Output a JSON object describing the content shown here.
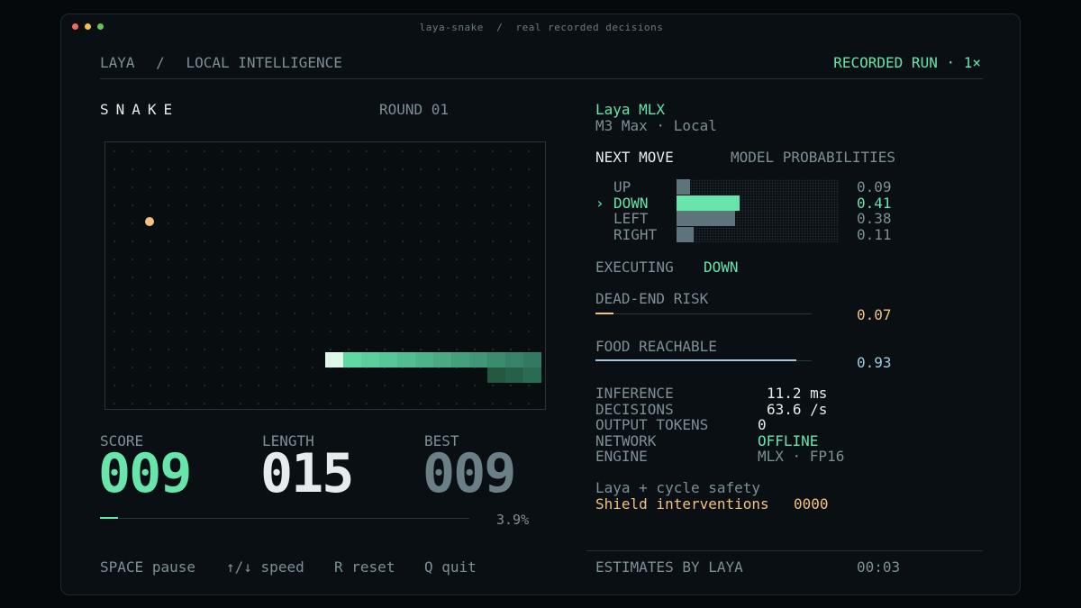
{
  "window": {
    "title": "laya-snake  /  real recorded decisions",
    "dot_colors": [
      "#ee6a5e",
      "#f5be4f",
      "#62c554"
    ]
  },
  "header": {
    "brand": "LAYA",
    "separator": "/",
    "section": "LOCAL INTELLIGENCE",
    "mode": "RECORDED RUN · 1×"
  },
  "game": {
    "title": "SNAKE",
    "round": "ROUND 01",
    "board": {
      "cols": 24,
      "rows": 15
    },
    "food": {
      "col": 1,
      "row": 4
    },
    "snake": [
      {
        "col": 12,
        "row": 12,
        "color": "#dff8ec"
      },
      {
        "col": 13,
        "row": 12,
        "color": "#5fd8a2"
      },
      {
        "col": 14,
        "row": 12,
        "color": "#5bd09d"
      },
      {
        "col": 15,
        "row": 12,
        "color": "#56c797"
      },
      {
        "col": 16,
        "row": 12,
        "color": "#52bd90"
      },
      {
        "col": 17,
        "row": 12,
        "color": "#4db38a"
      },
      {
        "col": 18,
        "row": 12,
        "color": "#49aa83"
      },
      {
        "col": 19,
        "row": 12,
        "color": "#44a07c"
      },
      {
        "col": 20,
        "row": 12,
        "color": "#409676"
      },
      {
        "col": 21,
        "row": 12,
        "color": "#3b8c6f"
      },
      {
        "col": 22,
        "row": 12,
        "color": "#378268"
      },
      {
        "col": 23,
        "row": 12,
        "color": "#337962"
      },
      {
        "col": 23,
        "row": 13,
        "color": "#2b6a53"
      },
      {
        "col": 22,
        "row": 13,
        "color": "#276049"
      },
      {
        "col": 21,
        "row": 13,
        "color": "#24573f"
      }
    ],
    "stats": {
      "score_label": "SCORE",
      "score": "009",
      "length_label": "LENGTH",
      "length": "015",
      "best_label": "BEST",
      "best": "009"
    },
    "progress": {
      "fraction": 0.039,
      "label": "3.9%"
    }
  },
  "model": {
    "name": "Laya MLX",
    "hardware": "M3 Max · Local",
    "next_move_label": "NEXT MOVE",
    "probabilities_label": "MODEL PROBABILITIES",
    "moves": [
      {
        "marker": "",
        "label": "UP",
        "prob": 0.09,
        "value": "0.09",
        "selected": false
      },
      {
        "marker": "›",
        "label": "DOWN",
        "prob": 0.41,
        "value": "0.41",
        "selected": true
      },
      {
        "marker": "",
        "label": "LEFT",
        "prob": 0.38,
        "value": "0.38",
        "selected": false
      },
      {
        "marker": "",
        "label": "RIGHT",
        "prob": 0.11,
        "value": "0.11",
        "selected": false
      }
    ],
    "executing_label": "EXECUTING",
    "executing_value": "DOWN",
    "dead_end": {
      "label": "DEAD-END RISK",
      "fraction": 0.07,
      "value": "0.07"
    },
    "food_reachable": {
      "label": "FOOD REACHABLE",
      "fraction": 0.93,
      "value": "0.93"
    },
    "metrics": [
      {
        "label": "INFERENCE",
        "value": "11.2 ms"
      },
      {
        "label": "DECISIONS",
        "value": "63.6 /s"
      },
      {
        "label": "OUTPUT TOKENS",
        "value": "0"
      },
      {
        "label": "NETWORK",
        "value": "OFFLINE"
      },
      {
        "label": "ENGINE",
        "value": "MLX · FP16"
      }
    ],
    "safety_title": "Laya + cycle safety",
    "shield_label": "Shield interventions",
    "shield_value": "0000"
  },
  "footer": {
    "controls": [
      {
        "key": "SPACE",
        "action": "pause"
      },
      {
        "key": "↑/↓",
        "action": "speed"
      },
      {
        "key": "R",
        "action": "reset"
      },
      {
        "key": "Q",
        "action": "quit"
      }
    ],
    "estimates": "ESTIMATES BY LAYA",
    "timer": "00:03"
  },
  "colors": {
    "accent_green": "#67e5ab",
    "orange": "#f3c27c",
    "blue": "#9ecbe0",
    "food": "#f3c27c"
  }
}
